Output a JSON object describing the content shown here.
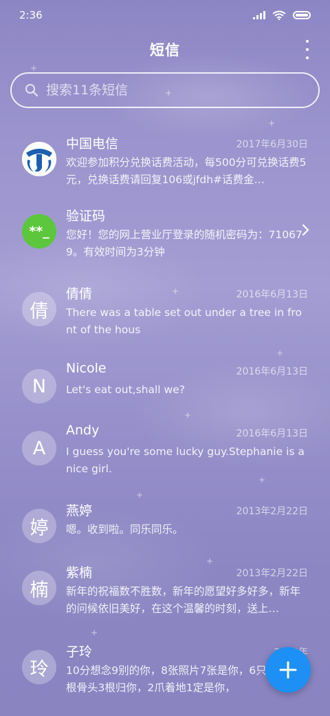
{
  "status_bar": {
    "time": "2:36"
  },
  "header": {
    "title": "短信",
    "more_icon": "more-vert-icon"
  },
  "search": {
    "placeholder": "搜索11条短信"
  },
  "conversations": [
    {
      "name": "中国电信",
      "date": "2017年6月30日",
      "preview": "欢迎参加积分兑换话费活动，每500分可兑换话费5元，兑换话费请回复106或jfdh#话费金…",
      "avatar_type": "telecom-logo"
    },
    {
      "name": "验证码",
      "date": "",
      "preview": "您好！您的网上营业厅登录的随机密码为：710679。有效时间为3分钟",
      "avatar_text": "**_",
      "avatar_color": "#5cc63d"
    },
    {
      "name": "倩倩",
      "date": "2016年6月13日",
      "preview": "There was a table set out under a tree in front of the hous",
      "avatar_text": "倩"
    },
    {
      "name": "Nicole",
      "date": "2016年6月13日",
      "preview": "Let's eat out,shall we?",
      "avatar_text": "N"
    },
    {
      "name": "Andy",
      "date": "2016年6月13日",
      "preview": "I guess you're some lucky guy.Stephanie is a nice girl.",
      "avatar_text": "A"
    },
    {
      "name": "燕婷",
      "date": "2013年2月22日",
      "preview": "嗯。收到啦。同乐同乐。",
      "avatar_text": "婷"
    },
    {
      "name": "紫楠",
      "date": "2013年2月22日",
      "preview": "新年的祝福数不胜数，新年的愿望好多好多，新年的问候依旧美好，在这个温馨的时刻，送上…",
      "avatar_text": "楠"
    },
    {
      "name": "子玲",
      "date": "2013年",
      "preview": "10分想念9别的你，8张照片7张是你，6只像你，4根骨头3根归你，2爪着地1定是你，",
      "avatar_text": "玲"
    }
  ],
  "fab": {
    "icon": "plus-icon"
  },
  "colors": {
    "accent": "#1e8ff4",
    "verify_avatar": "#5cc63d",
    "telecom_blue": "#1d5fb0"
  }
}
